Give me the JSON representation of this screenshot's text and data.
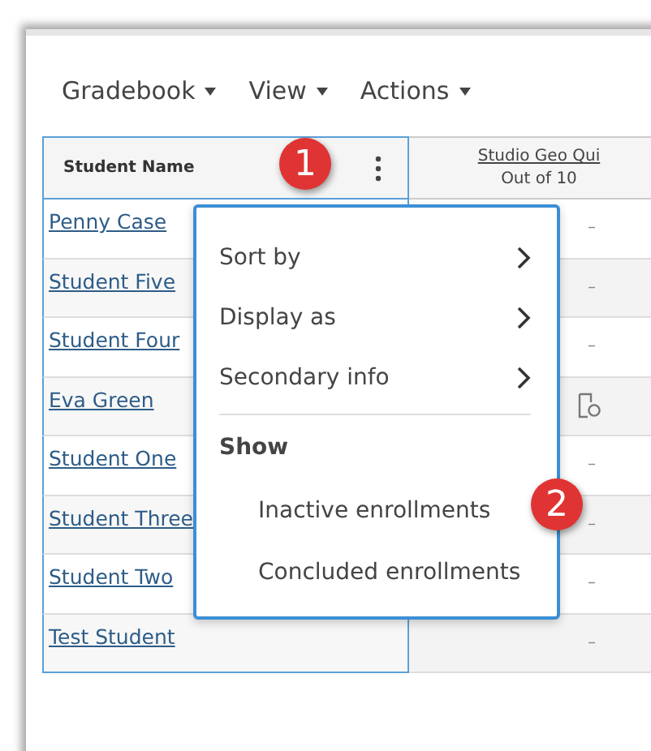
{
  "toolbar": {
    "menus": [
      {
        "label": "Gradebook"
      },
      {
        "label": "View"
      },
      {
        "label": "Actions"
      }
    ]
  },
  "table": {
    "columns": [
      {
        "label": "Student Name"
      },
      {
        "label": "Studio Geo Qui",
        "sublabel": "Out of 10"
      }
    ],
    "rows": [
      {
        "name": "Penny Case",
        "score": "–",
        "kind": "text"
      },
      {
        "name": "Student Five",
        "score": "–",
        "kind": "text"
      },
      {
        "name": "Student Four",
        "score": "–",
        "kind": "text"
      },
      {
        "name": "Eva Green",
        "kind": "icon"
      },
      {
        "name": "Student One",
        "score": "–",
        "kind": "text"
      },
      {
        "name": "Student Three",
        "score": "–",
        "kind": "text"
      },
      {
        "name": "Student Two",
        "score": "–",
        "kind": "text"
      },
      {
        "name": "Test Student",
        "score": "–",
        "kind": "text"
      }
    ]
  },
  "menu": {
    "items": [
      {
        "label": "Sort by",
        "kind": "submenu"
      },
      {
        "label": "Display as",
        "kind": "submenu"
      },
      {
        "label": "Secondary info",
        "kind": "submenu"
      },
      {
        "kind": "divider"
      },
      {
        "label": "Show",
        "kind": "heading"
      },
      {
        "label": "Inactive enrollments",
        "kind": "option"
      },
      {
        "label": "Concluded enrollments",
        "kind": "option"
      }
    ]
  },
  "callouts": [
    {
      "label": "1"
    },
    {
      "label": "2"
    }
  ]
}
